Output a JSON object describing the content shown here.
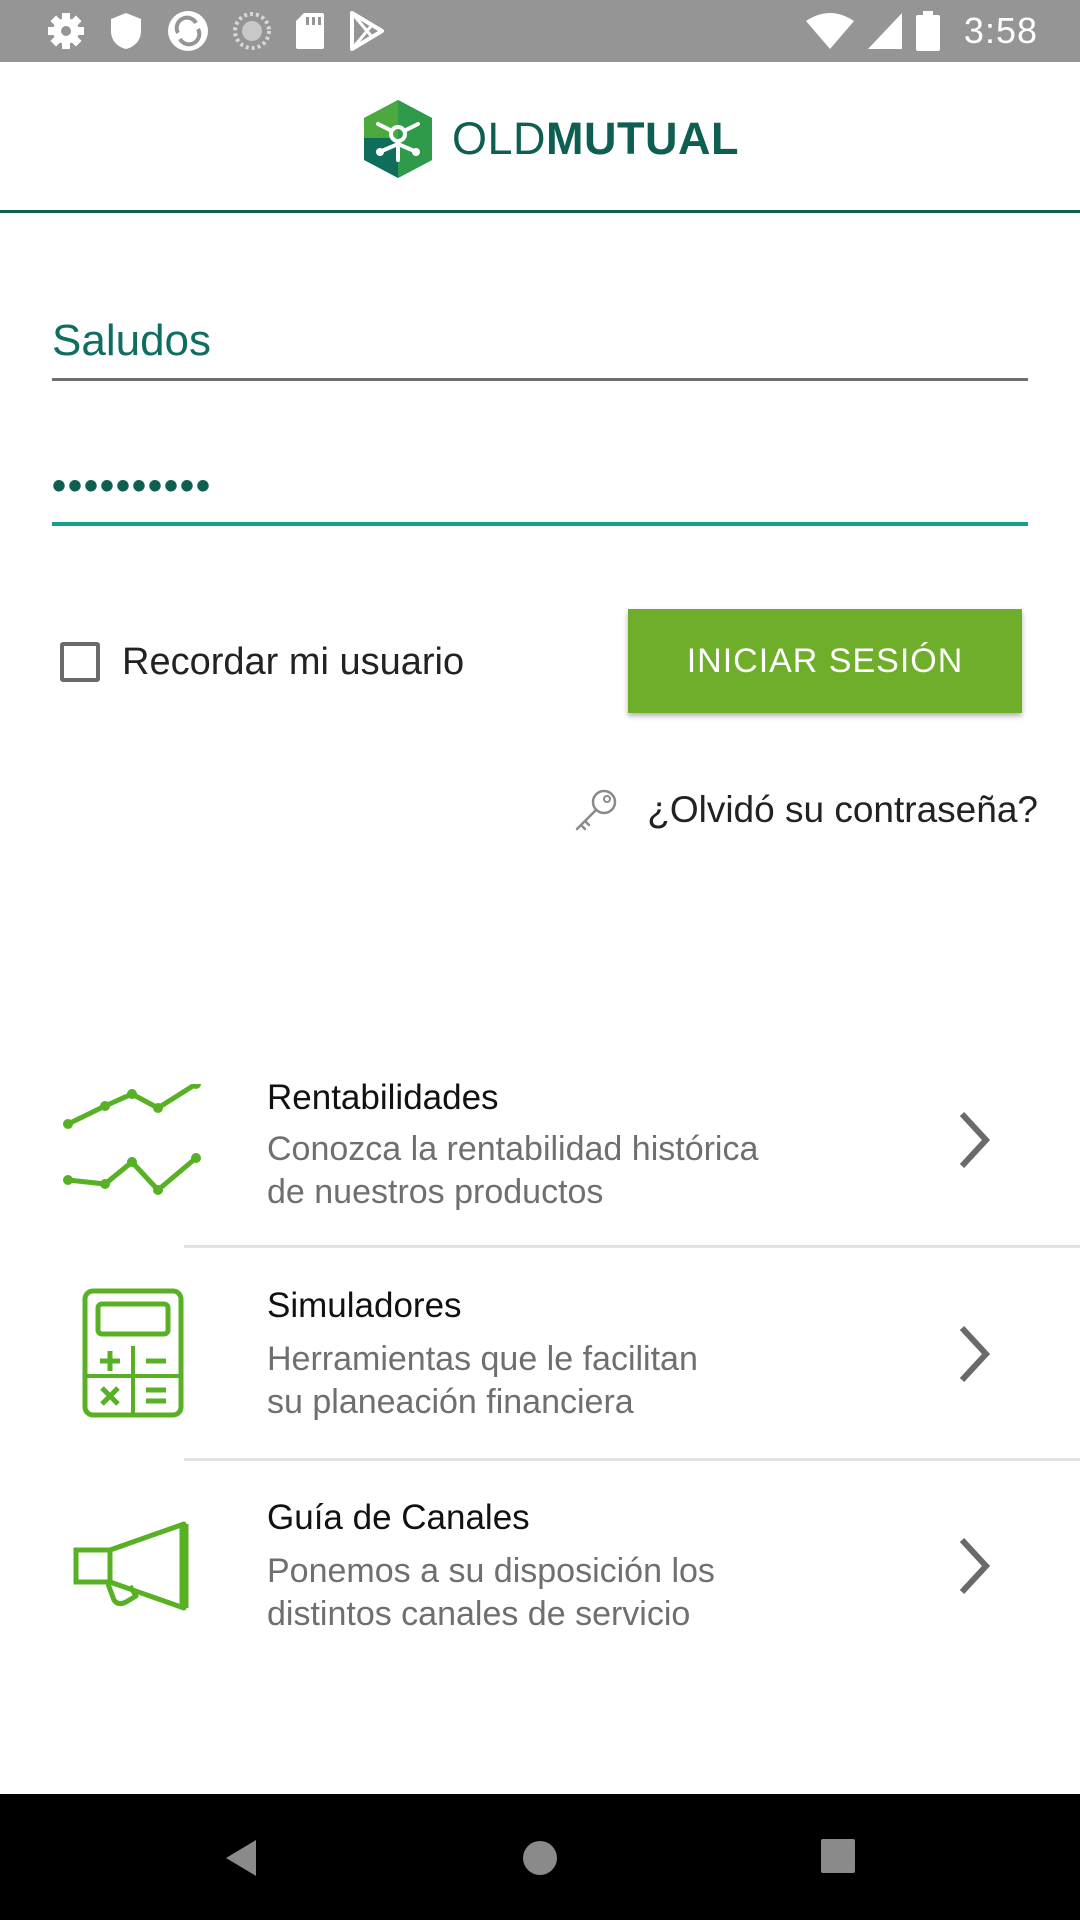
{
  "status_bar": {
    "time": "3:58",
    "left_icons": [
      "settings-icon",
      "shield-icon",
      "sync-icon",
      "loading-icon",
      "sd-card-icon",
      "play-store-icon"
    ],
    "right_icons": [
      "wifi-icon",
      "signal-icon",
      "battery-icon"
    ]
  },
  "header": {
    "logo_light": "OLD",
    "logo_bold": "MUTUAL"
  },
  "login": {
    "username_value": "Saludos",
    "password_value": "••••••••••",
    "remember_label": "Recordar mi usuario",
    "remember_checked": false,
    "login_button": "INICIAR SESIÓN",
    "forgot_label": "¿Olvidó su contraseña?"
  },
  "menu": {
    "items": [
      {
        "title": "Rentabilidades",
        "desc_line1": "Conozca la rentabilidad histórica",
        "desc_line2": "de nuestros productos",
        "icon": "line-chart-icon"
      },
      {
        "title": "Simuladores",
        "desc_line1": "Herramientas que le facilitan",
        "desc_line2": "su planeación financiera",
        "icon": "calculator-icon"
      },
      {
        "title": "Guía de Canales",
        "desc_line1": "Ponemos a su disposición los",
        "desc_line2": "distintos canales de servicio",
        "icon": "megaphone-icon"
      }
    ]
  },
  "colors": {
    "brand_green": "#6fae2a",
    "brand_teal": "#0e5e51",
    "accent_teal": "#12a08a",
    "status_bar": "#959595"
  },
  "nav_bar": {
    "buttons": [
      "back-icon",
      "home-icon",
      "recents-icon"
    ]
  }
}
